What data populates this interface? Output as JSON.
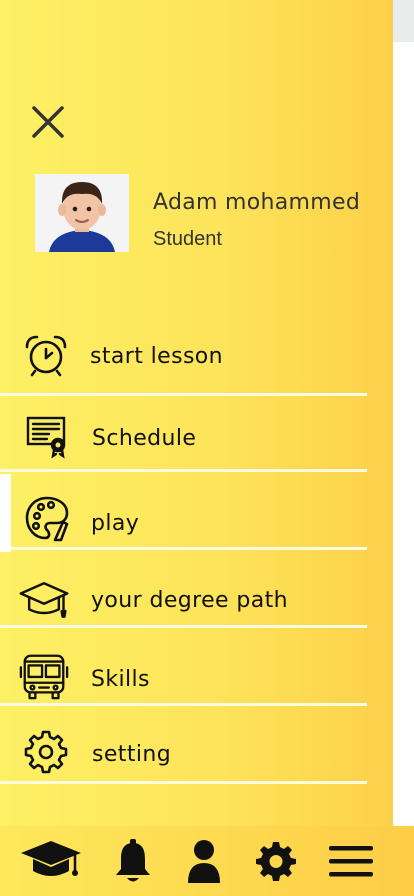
{
  "profile": {
    "name": "Adam mohammed",
    "role": "Student"
  },
  "menu": [
    {
      "label": "start lesson",
      "icon": "alarm-clock-icon"
    },
    {
      "label": "Schedule",
      "icon": "certificate-icon"
    },
    {
      "label": "play",
      "icon": "palette-icon",
      "active": true
    },
    {
      "label": "your degree path",
      "icon": "graduation-cap-icon"
    },
    {
      "label": "Skills",
      "icon": "school-bus-icon"
    },
    {
      "label": "setting",
      "icon": "gear-icon"
    }
  ],
  "bottom_nav": [
    "graduation-cap-icon",
    "bell-icon",
    "user-icon",
    "gear-icon",
    "menu-icon"
  ],
  "colors": {
    "drawer_start": "#fdf064",
    "drawer_end": "#fdd04a",
    "text": "#111111",
    "divider": "#fffbe0"
  }
}
